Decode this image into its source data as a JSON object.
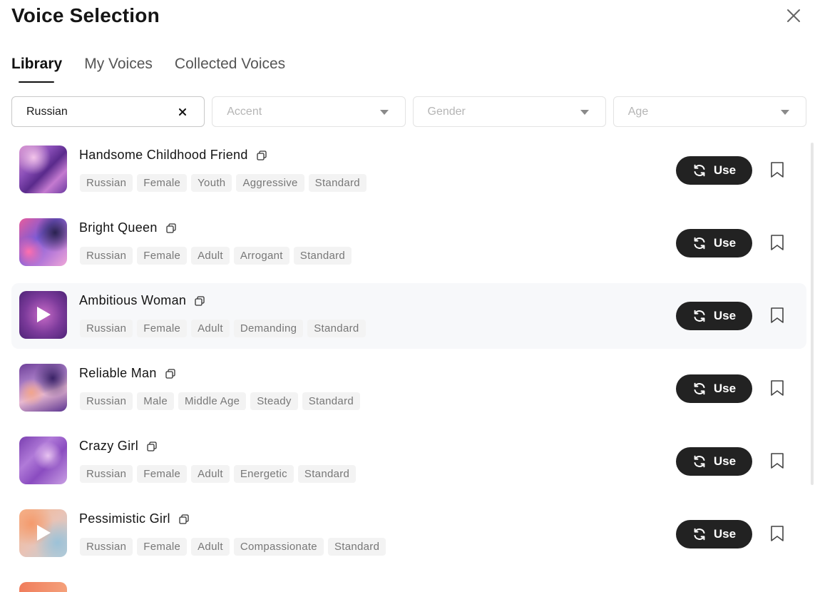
{
  "header": {
    "title": "Voice Selection"
  },
  "tabs": [
    {
      "label": "Library"
    },
    {
      "label": "My Voices"
    },
    {
      "label": "Collected Voices"
    }
  ],
  "filters": {
    "search_value": "Russian",
    "accent_placeholder": "Accent",
    "gender_placeholder": "Gender",
    "age_placeholder": "Age"
  },
  "use_label": "Use",
  "voices": [
    {
      "name": "Handsome Childhood Friend",
      "tags": [
        "Russian",
        "Female",
        "Youth",
        "Aggressive",
        "Standard"
      ]
    },
    {
      "name": "Bright Queen",
      "tags": [
        "Russian",
        "Female",
        "Adult",
        "Arrogant",
        "Standard"
      ]
    },
    {
      "name": "Ambitious Woman",
      "tags": [
        "Russian",
        "Female",
        "Adult",
        "Demanding",
        "Standard"
      ]
    },
    {
      "name": "Reliable Man",
      "tags": [
        "Russian",
        "Male",
        "Middle Age",
        "Steady",
        "Standard"
      ]
    },
    {
      "name": "Crazy Girl",
      "tags": [
        "Russian",
        "Female",
        "Adult",
        "Energetic",
        "Standard"
      ]
    },
    {
      "name": "Pessimistic Girl",
      "tags": [
        "Russian",
        "Female",
        "Adult",
        "Compassionate",
        "Standard"
      ]
    }
  ],
  "colors": {
    "button_dark": "#222222",
    "tag_bg": "#f3f3f3",
    "tag_text": "#777777"
  }
}
